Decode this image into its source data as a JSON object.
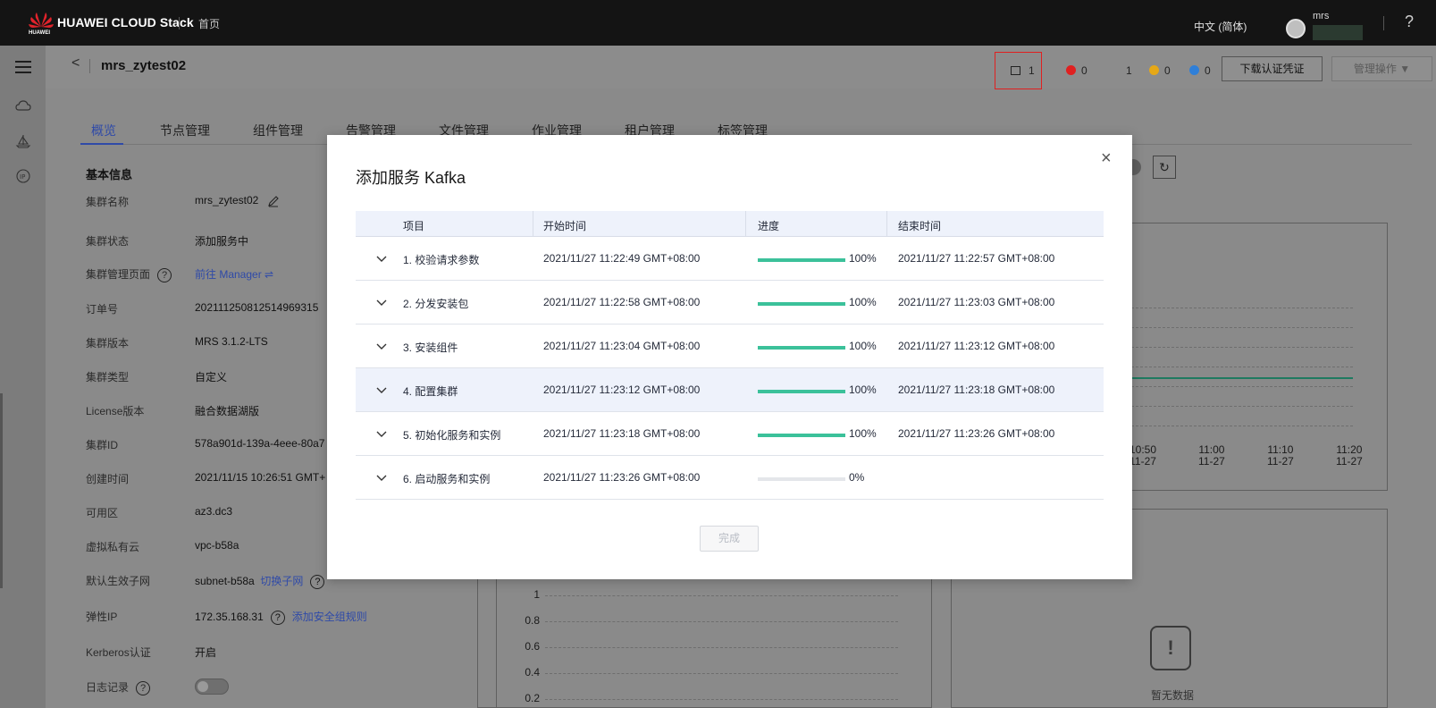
{
  "header": {
    "brand": "HUAWEI CLOUD Stack",
    "brand_sub": "HUAWEI",
    "home": "首页",
    "language": "中文 (简体)",
    "user": "mrs",
    "help": "?"
  },
  "page": {
    "back": "<",
    "title": "mrs_zytest02",
    "task_count": "1",
    "alarms": [
      {
        "color": "#e02020",
        "count": "0"
      },
      {
        "color": "#e6a817",
        "count": "1"
      },
      {
        "color": "#e6a817",
        "count": "0"
      },
      {
        "color": "#2f7fd8",
        "count": "0"
      }
    ],
    "download_button": "下载认证凭证",
    "manage_button": "管理操作 ▼"
  },
  "tabs": [
    "概览",
    "节点管理",
    "组件管理",
    "告警管理",
    "文件管理",
    "作业管理",
    "租户管理",
    "标签管理"
  ],
  "basic_info": {
    "heading": "基本信息",
    "rows": [
      {
        "label": "集群名称",
        "value": "mrs_zytest02"
      },
      {
        "label": "集群状态",
        "value": "添加服务中"
      },
      {
        "label": "集群管理页面",
        "value": "前往 Manager ⇌"
      },
      {
        "label": "订单号",
        "value": "202111250812514969315"
      },
      {
        "label": "集群版本",
        "value": "MRS 3.1.2-LTS"
      },
      {
        "label": "集群类型",
        "value": "自定义"
      },
      {
        "label": "License版本",
        "value": "融合数据湖版"
      },
      {
        "label": "集群ID",
        "value": "578a901d-139a-4eee-80a7"
      },
      {
        "label": "创建时间",
        "value": "2021/11/15 10:26:51 GMT+"
      },
      {
        "label": "可用区",
        "value": "az3.dc3"
      },
      {
        "label": "虚拟私有云",
        "value": "vpc-b58a"
      },
      {
        "label": "默认生效子网",
        "value": "subnet-b58a",
        "link": "切换子网"
      },
      {
        "label": "弹性IP",
        "value": "172.35.168.31",
        "link": "添加安全组规则"
      },
      {
        "label": "Kerberos认证",
        "value": "开启"
      },
      {
        "label": "日志记录",
        "value": ""
      }
    ]
  },
  "chart_bg": {
    "x_ticks": [
      {
        "time": "10:50",
        "date": "11-27"
      },
      {
        "time": "11:00",
        "date": "11-27"
      },
      {
        "time": "11:10",
        "date": "11-27"
      },
      {
        "time": "11:20",
        "date": "11-27"
      }
    ],
    "y_ticks": [
      "1",
      "0.8",
      "0.6",
      "0.4",
      "0.2"
    ],
    "panel_title": ")",
    "no_data": "暂无数据"
  },
  "modal": {
    "title": "添加服务 Kafka",
    "columns": [
      "项目",
      "开始时间",
      "进度",
      "结束时间"
    ],
    "rows": [
      {
        "item": "1. 校验请求参数",
        "start": "2021/11/27 11:22:49 GMT+08:00",
        "progress": 100,
        "progress_label": "100%",
        "end": "2021/11/27 11:22:57 GMT+08:00"
      },
      {
        "item": "2. 分发安装包",
        "start": "2021/11/27 11:22:58 GMT+08:00",
        "progress": 100,
        "progress_label": "100%",
        "end": "2021/11/27 11:23:03 GMT+08:00"
      },
      {
        "item": "3. 安装组件",
        "start": "2021/11/27 11:23:04 GMT+08:00",
        "progress": 100,
        "progress_label": "100%",
        "end": "2021/11/27 11:23:12 GMT+08:00"
      },
      {
        "item": "4. 配置集群",
        "start": "2021/11/27 11:23:12 GMT+08:00",
        "progress": 100,
        "progress_label": "100%",
        "end": "2021/11/27 11:23:18 GMT+08:00"
      },
      {
        "item": "5. 初始化服务和实例",
        "start": "2021/11/27 11:23:18 GMT+08:00",
        "progress": 100,
        "progress_label": "100%",
        "end": "2021/11/27 11:23:26 GMT+08:00"
      },
      {
        "item": "6. 启动服务和实例",
        "start": "2021/11/27 11:23:26 GMT+08:00",
        "progress": 0,
        "progress_label": "0%",
        "end": ""
      }
    ],
    "done_button": "完成",
    "close": "×"
  }
}
